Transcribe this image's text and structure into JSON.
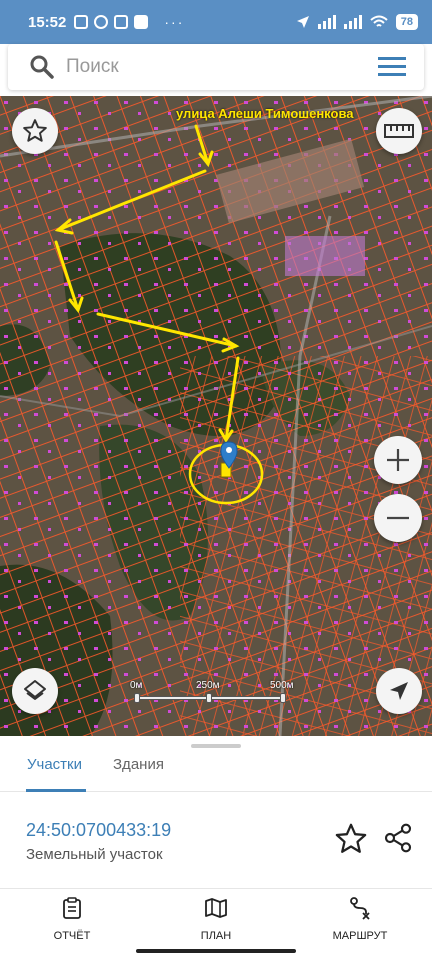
{
  "status_bar": {
    "time": "15:52",
    "dots": "···",
    "battery": "78"
  },
  "search": {
    "placeholder": "Поиск",
    "icon": "search-icon",
    "menu_icon": "hamburger-menu-icon"
  },
  "map": {
    "street_annotation": "улица Алеши Тимошенкова",
    "scale": {
      "labels": [
        "0м",
        "250м",
        "500м"
      ]
    },
    "controls": [
      "star-icon",
      "ruler-icon",
      "zoom-in-icon",
      "zoom-out-icon",
      "layers-icon",
      "locate-arrow-icon"
    ],
    "colors": {
      "parcel_border": "#ff5a2a",
      "annotation": "#ffe600",
      "marker": "#2f7ec9"
    }
  },
  "sheet": {
    "tabs": [
      {
        "label": "Участки",
        "active": true
      },
      {
        "label": "Здания",
        "active": false
      }
    ],
    "parcel": {
      "cadastral_number": "24:50:0700433:19",
      "type": "Земельный участок"
    },
    "bottom_nav": [
      {
        "label": "ОТЧЁТ",
        "icon": "report-clipboard-icon"
      },
      {
        "label": "ПЛАН",
        "icon": "map-plan-icon"
      },
      {
        "label": "МАРШРУТ",
        "icon": "route-icon"
      }
    ],
    "accent_color": "#3d7fb6"
  }
}
